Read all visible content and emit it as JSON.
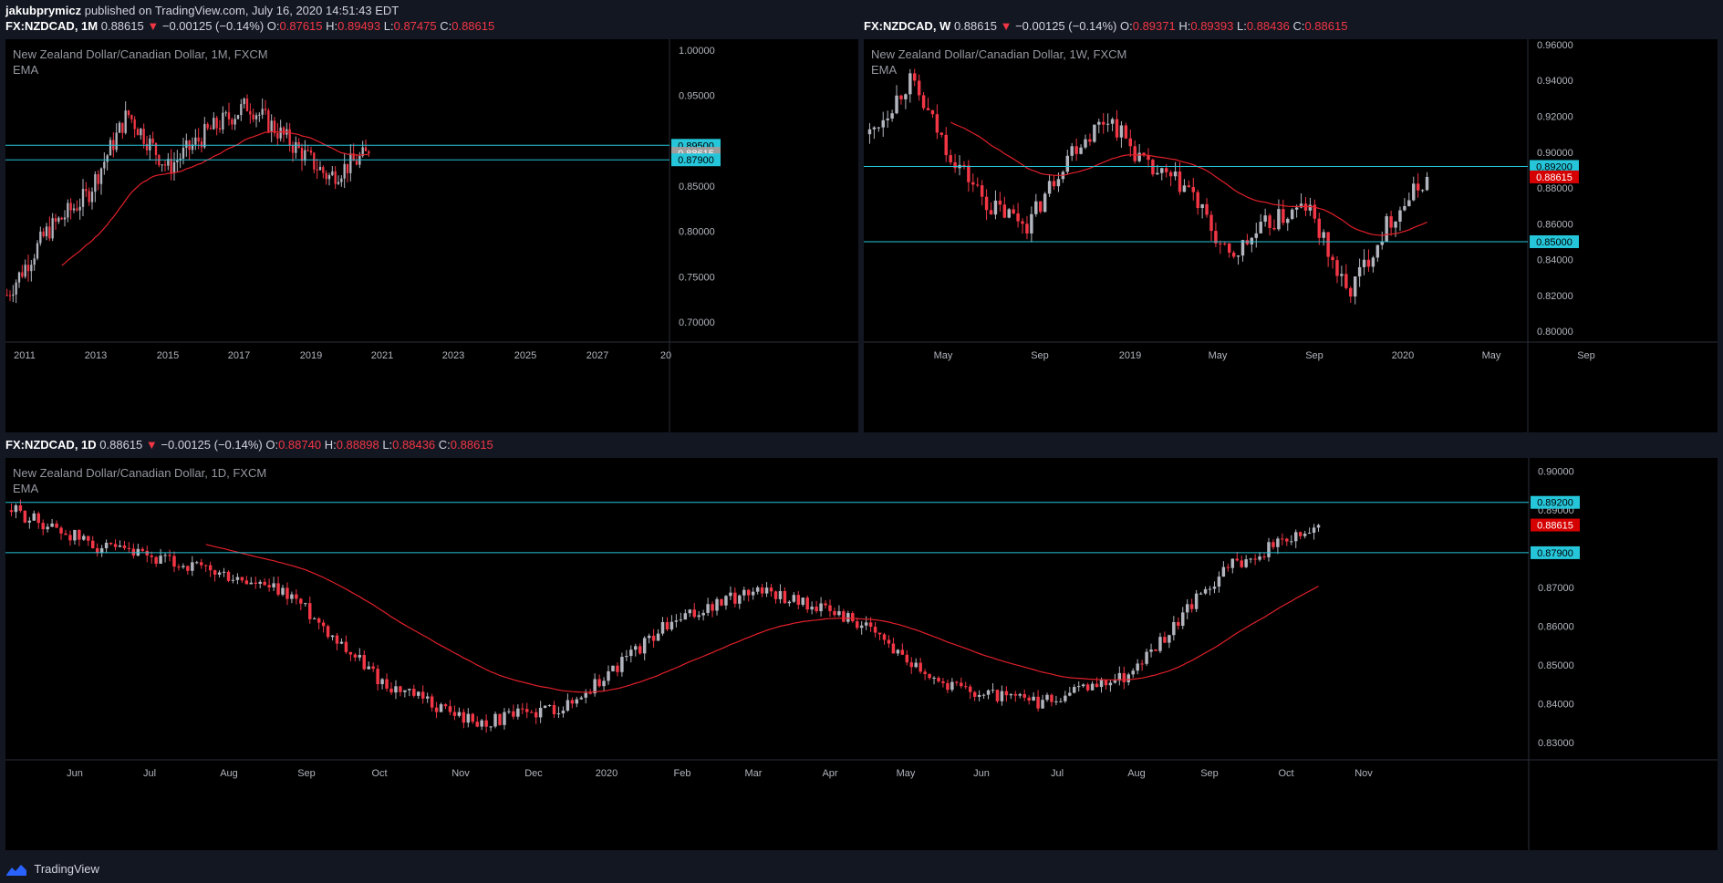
{
  "header": {
    "author": "jakubprymicz",
    "published": "published on TradingView.com, July 16, 2020 14:51:43 EDT"
  },
  "charts": [
    {
      "id": "monthly",
      "symbol": "FX:NZDCAD, 1M",
      "last": "0.88615",
      "change": "−0.00125 (−0.14%)",
      "o": "0.87615",
      "h": "0.89493",
      "l": "0.87475",
      "c": "0.88615",
      "legend_title": "New Zealand Dollar/Canadian Dollar, 1M, FXCM",
      "legend_ind": "EMA",
      "y_ticks": [
        "1.00000",
        "0.95000",
        "0.85000",
        "0.80000",
        "0.75000",
        "0.70000"
      ],
      "x_ticks": [
        "2011",
        "2013",
        "2015",
        "2017",
        "2019",
        "2021",
        "2023",
        "2025",
        "2027",
        "20"
      ],
      "levels": [
        {
          "label": "0.89500",
          "price": 0.895,
          "type": "level"
        },
        {
          "label": "0.88615",
          "price": 0.88615,
          "type": "last"
        },
        {
          "label": "0.87900",
          "price": 0.879,
          "type": "level"
        }
      ]
    },
    {
      "id": "weekly",
      "symbol": "FX:NZDCAD, W",
      "last": "0.88615",
      "change": "−0.00125 (−0.14%)",
      "o": "0.89371",
      "h": "0.89393",
      "l": "0.88436",
      "c": "0.88615",
      "legend_title": "New Zealand Dollar/Canadian Dollar, 1W, FXCM",
      "legend_ind": "EMA",
      "y_ticks": [
        "0.96000",
        "0.94000",
        "0.92000",
        "0.90000",
        "0.88000",
        "0.86000",
        "0.84000",
        "0.82000",
        "0.80000"
      ],
      "x_ticks": [
        "May",
        "Sep",
        "2019",
        "May",
        "Sep",
        "2020",
        "May",
        "Sep"
      ],
      "levels": [
        {
          "label": "0.89200",
          "price": 0.892,
          "type": "level"
        },
        {
          "label": "0.88615",
          "price": 0.88615,
          "type": "last"
        },
        {
          "label": "0.85000",
          "price": 0.85,
          "type": "level"
        }
      ]
    },
    {
      "id": "daily",
      "symbol": "FX:NZDCAD, 1D",
      "last": "0.88615",
      "change": "−0.00125 (−0.14%)",
      "o": "0.88740",
      "h": "0.88898",
      "l": "0.88436",
      "c": "0.88615",
      "legend_title": "New Zealand Dollar/Canadian Dollar, 1D, FXCM",
      "legend_ind": "EMA",
      "y_ticks": [
        "0.90000",
        "0.89000",
        "0.87000",
        "0.86000",
        "0.85000",
        "0.84000",
        "0.83000"
      ],
      "x_ticks": [
        "Jun",
        "Jul",
        "Aug",
        "Sep",
        "Oct",
        "Nov",
        "Dec",
        "2020",
        "Feb",
        "Mar",
        "Apr",
        "May",
        "Jun",
        "Jul",
        "Aug",
        "Sep",
        "Oct",
        "Nov"
      ],
      "levels": [
        {
          "label": "0.89200",
          "price": 0.892,
          "type": "level"
        },
        {
          "label": "0.88615",
          "price": 0.88615,
          "type": "last"
        },
        {
          "label": "0.87900",
          "price": 0.879,
          "type": "level"
        }
      ]
    }
  ],
  "chart_data": [
    {
      "type": "line",
      "x": [
        "2011",
        "2012",
        "2013",
        "2014",
        "2015",
        "2016",
        "2017",
        "2018",
        "2019",
        "2020"
      ],
      "series": [
        {
          "values": [
            0.73,
            0.8,
            0.84,
            0.93,
            0.87,
            0.91,
            0.94,
            0.9,
            0.86,
            0.886
          ]
        }
      ],
      "ylim": [
        0.68,
        1.01
      ]
    },
    {
      "type": "line",
      "x": [
        "2018-03",
        "2018-05",
        "2018-07",
        "2018-09",
        "2018-11",
        "2019-01",
        "2019-03",
        "2019-05",
        "2019-07",
        "2019-09",
        "2019-11",
        "2020-01",
        "2020-03",
        "2020-05",
        "2020-07"
      ],
      "series": [
        {
          "values": [
            0.91,
            0.94,
            0.9,
            0.87,
            0.86,
            0.9,
            0.92,
            0.89,
            0.88,
            0.84,
            0.86,
            0.87,
            0.82,
            0.86,
            0.886
          ]
        }
      ],
      "ylim": [
        0.795,
        0.962
      ]
    },
    {
      "type": "line",
      "x": [
        "2019-05",
        "2019-06",
        "2019-07",
        "2019-08",
        "2019-09",
        "2019-10",
        "2019-11",
        "2019-12",
        "2020-01",
        "2020-02",
        "2020-03",
        "2020-04",
        "2020-05",
        "2020-06",
        "2020-07"
      ],
      "series": [
        {
          "values": [
            0.89,
            0.88,
            0.875,
            0.868,
            0.845,
            0.835,
            0.84,
            0.86,
            0.87,
            0.862,
            0.845,
            0.84,
            0.848,
            0.875,
            0.886
          ]
        }
      ],
      "ylim": [
        0.826,
        0.903
      ]
    }
  ],
  "footer": {
    "brand": "TradingView"
  },
  "colors": {
    "up": "#b2b5be",
    "down": "#f23645",
    "ema": "#e0202a",
    "level": "#26c6da",
    "last": "#d50000"
  }
}
